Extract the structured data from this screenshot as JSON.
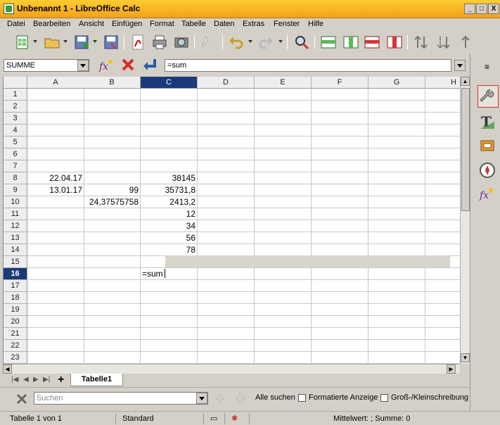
{
  "window": {
    "title": "Unbenannt 1 - LibreOffice Calc",
    "controls": [
      "_",
      "□",
      "X"
    ]
  },
  "menu": [
    "Datei",
    "Bearbeiten",
    "Ansicht",
    "Einfügen",
    "Format",
    "Tabelle",
    "Daten",
    "Extras",
    "Fenster",
    "Hilfe"
  ],
  "toolbar": {
    "icons": [
      "new-document-icon",
      "open-folder-icon",
      "save-icon",
      "save-as-icon",
      "pdf-export-icon",
      "print-icon",
      "print-preview-icon",
      "clone-formatting-icon",
      "undo-icon",
      "redo-icon",
      "find-replace-icon",
      "insert-rows-icon",
      "insert-columns-icon",
      "delete-rows-icon",
      "delete-columns-icon",
      "sort-ascending-icon",
      "sort-descending-icon",
      "autofilter-icon"
    ]
  },
  "formula_bar": {
    "name_box": "SUMME",
    "formula": "=sum"
  },
  "sheet": {
    "columns": [
      "A",
      "B",
      "C",
      "D",
      "E",
      "F",
      "G",
      "H"
    ],
    "selected_column": "C",
    "rows": [
      "1",
      "2",
      "3",
      "4",
      "5",
      "6",
      "7",
      "8",
      "9",
      "10",
      "11",
      "12",
      "13",
      "14",
      "15",
      "16",
      "17",
      "18",
      "19",
      "20",
      "21",
      "22",
      "23"
    ],
    "selected_row": "16",
    "cells": {
      "A8": "22.04.17",
      "C8": "38145",
      "A9": "13.01.17",
      "B9": "99",
      "C9": "35731,8",
      "B10": "24,37575758",
      "C10": "2413,2",
      "C11": "12",
      "C12": "34",
      "C13": "56",
      "C14": "78",
      "C16": "=sum"
    }
  },
  "tabs": {
    "add": "+",
    "sheets": [
      "Tabelle1"
    ]
  },
  "find": {
    "placeholder": "Suchen",
    "find_all": "Alle suchen",
    "formatted": "Formatierte Anzeige",
    "match_case": "Groß-/Kleinschreibung"
  },
  "status": {
    "sheet": "Tabelle 1 von 1",
    "style": "Standard",
    "sum": "Mittelwert: ; Summe: 0"
  },
  "colors": {
    "title_gradient_top": "#ffcc33",
    "title_gradient_bottom": "#f3a11a",
    "selection_header": "#1b3a7a"
  }
}
